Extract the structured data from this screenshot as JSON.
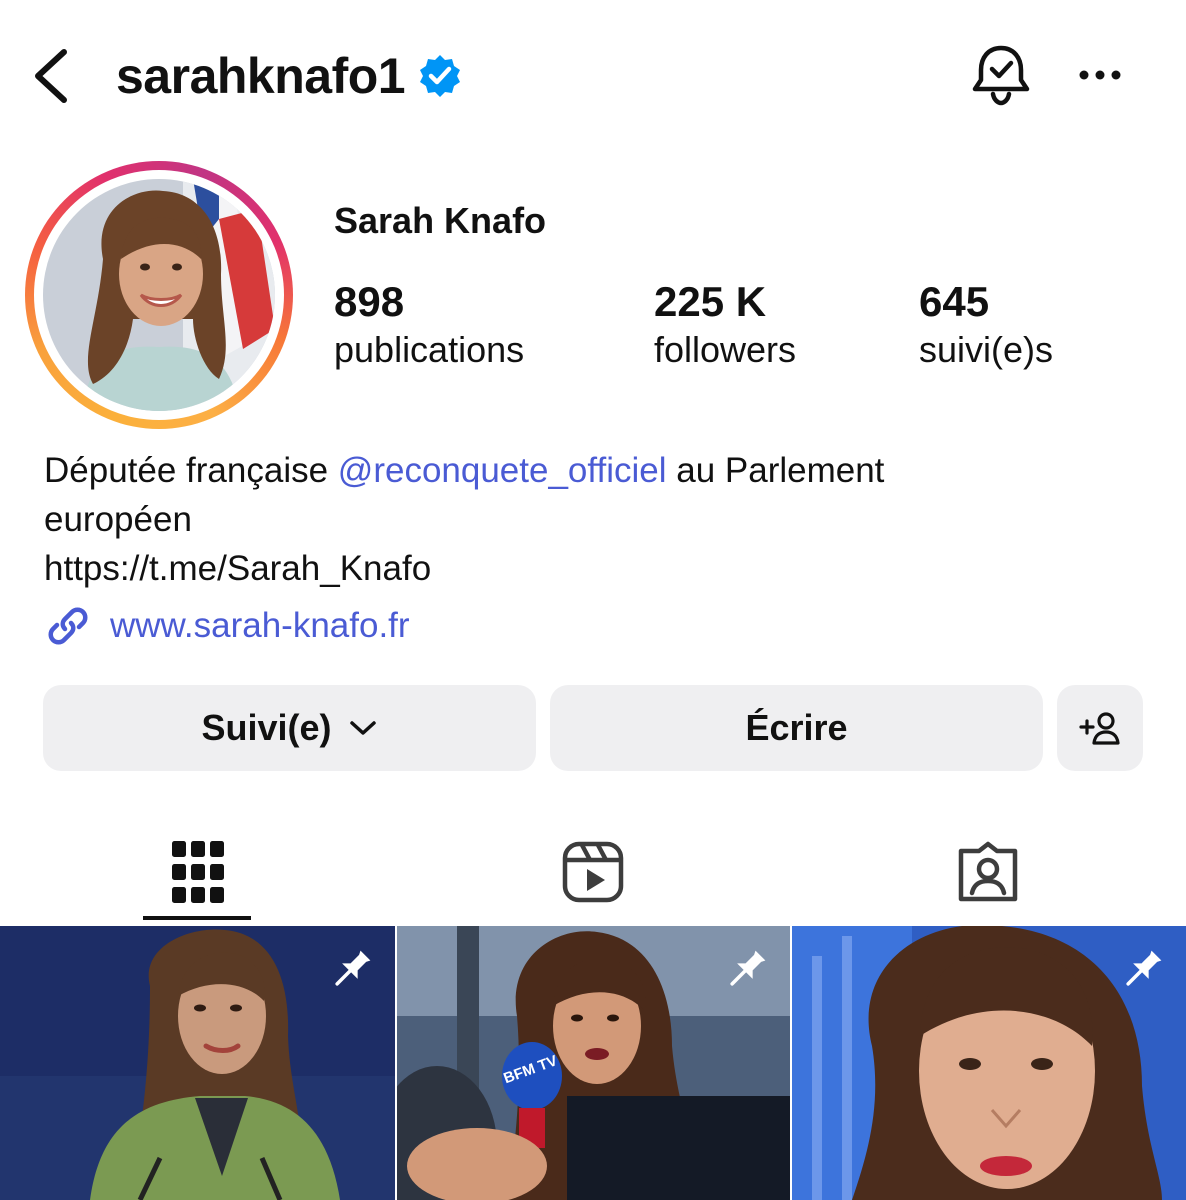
{
  "header": {
    "username": "sarahknafo1"
  },
  "profile": {
    "display_name": "Sarah Knafo",
    "stats": {
      "posts_count": "898",
      "posts_label": "publications",
      "followers_count": "225 K",
      "followers_label": "followers",
      "following_count": "645",
      "following_label": "suivi(e)s"
    }
  },
  "bio": {
    "text_before": "Députée française ",
    "mention": "@reconquete_officiel",
    "text_after": " au Parlement européen",
    "line2": "https://t.me/Sarah_Knafo",
    "website": "www.sarah-knafo.fr"
  },
  "actions": {
    "follow_label": "Suivi(e)",
    "message_label": "Écrire"
  },
  "tabs": [
    {
      "name": "posts-grid",
      "icon": "grid-icon",
      "active": true
    },
    {
      "name": "reels",
      "icon": "reels-icon",
      "active": false
    },
    {
      "name": "tagged",
      "icon": "tagged-icon",
      "active": false
    }
  ],
  "posts": [
    {
      "pinned": true
    },
    {
      "pinned": true,
      "mic_text": "BFM TV"
    },
    {
      "pinned": true
    }
  ],
  "colors": {
    "link": "#4a5bd4",
    "verified": "#0095f6",
    "button_bg": "#efeff1"
  }
}
